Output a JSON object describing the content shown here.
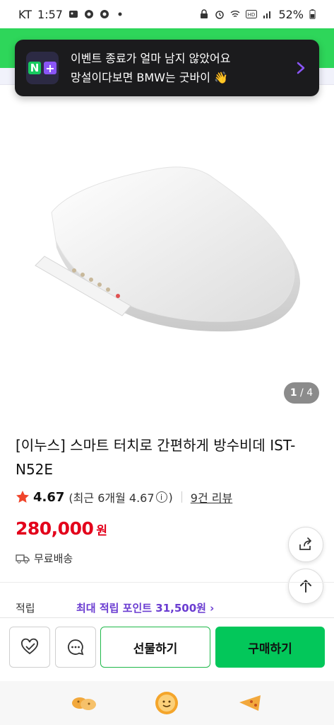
{
  "status_bar": {
    "carrier": "KT",
    "time": "1:57",
    "battery": "52%"
  },
  "toast": {
    "logo_n": "N",
    "logo_plus": "+",
    "line1": "이벤트 종료가 얼마 남지 않았어요",
    "line2": "망설이다보면 BMW는 굿바이 👋"
  },
  "gallery": {
    "current": "1",
    "separator": " / ",
    "total": "4"
  },
  "product": {
    "title": "[이누스] 스마트 터치로 간편하게 방수비데 IST-N52E",
    "rating": "4.67",
    "recent_rating_text": "(최근 6개월 4.67",
    "recent_rating_close": ")",
    "info_symbol": "i",
    "review_count": "9건 리뷰",
    "price": "280,000",
    "price_unit": "원",
    "delivery": "무료배송"
  },
  "points": {
    "label": "적립",
    "value": "최대 적립 포인트 31,500원 ›"
  },
  "actions": {
    "gift_label": "선물하기",
    "buy_label": "구매하기"
  },
  "colors": {
    "brand_green": "#03c75a",
    "price_red": "#e3001b",
    "points_purple": "#6a3cd1"
  }
}
